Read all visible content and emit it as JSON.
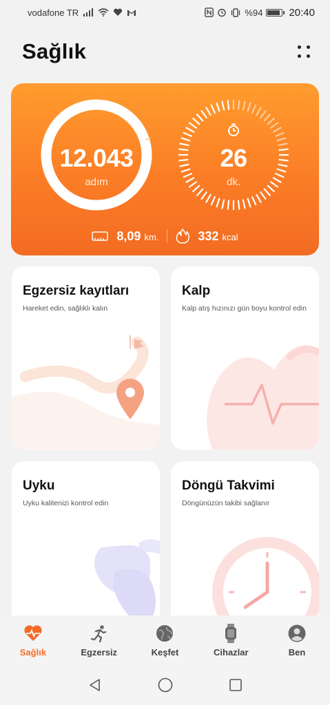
{
  "status_bar": {
    "carrier": "vodafone TR",
    "battery_text": "%94",
    "battery_level": 0.94,
    "time": "20:40"
  },
  "header": {
    "title": "Sağlık"
  },
  "activity": {
    "steps_value": "12.043",
    "steps_unit": "adım",
    "minutes_value": "26",
    "minutes_unit": "dk.",
    "distance_value": "8,09",
    "distance_unit": "km.",
    "calories_value": "332",
    "calories_unit": "kcal",
    "accent_color": "#fb7d26"
  },
  "cards": {
    "exercise": {
      "title": "Egzersiz kayıtları",
      "subtitle": "Hareket edin, sağlıklı kalın"
    },
    "heart": {
      "title": "Kalp",
      "subtitle": "Kalp atış hızınızı gün boyu kontrol edin"
    },
    "sleep": {
      "title": "Uyku",
      "subtitle": "Uyku kalitenizi kontrol edin"
    },
    "cycle": {
      "title": "Döngü Takvimi",
      "subtitle": "Döngünüzün takibi sağlanır"
    }
  },
  "bottom_nav": {
    "items": [
      {
        "label": "Sağlık",
        "icon": "heart-pulse-icon",
        "active": true
      },
      {
        "label": "Egzersiz",
        "icon": "running-icon",
        "active": false
      },
      {
        "label": "Keşfet",
        "icon": "globe-icon",
        "active": false
      },
      {
        "label": "Cihazlar",
        "icon": "watch-icon",
        "active": false
      },
      {
        "label": "Ben",
        "icon": "profile-icon",
        "active": false
      }
    ],
    "active_color": "#f56b2a"
  },
  "system_nav": {
    "buttons": [
      "back-icon",
      "home-icon",
      "recents-icon"
    ]
  }
}
